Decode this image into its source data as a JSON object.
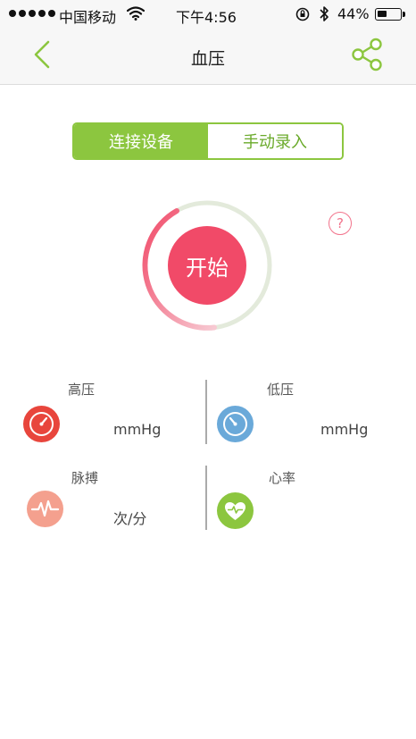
{
  "status_bar": {
    "carrier": "中国移动",
    "time": "下午4:56",
    "battery": "44%",
    "battery_level": 0.44
  },
  "nav": {
    "title": "血压"
  },
  "mode_tabs": [
    {
      "label": "连接设备",
      "selected": true
    },
    {
      "label": "手动录入",
      "selected": false
    }
  ],
  "start": {
    "label": "开始",
    "help": "?"
  },
  "metrics": {
    "systolic": {
      "label": "高压",
      "unit": "mmHg"
    },
    "diastolic": {
      "label": "低压",
      "unit": "mmHg"
    },
    "pulse": {
      "label": "脉搏",
      "unit": "次/分"
    },
    "heart_rate": {
      "label": "心率",
      "unit": ""
    }
  },
  "colors": {
    "accent_green": "#8cc63f",
    "accent_red": "#f14a68",
    "systolic_icon": "#e8453c",
    "diastolic_icon": "#6aa9d9",
    "pulse_icon": "#f4a08e",
    "heart_icon": "#8cc63f"
  }
}
